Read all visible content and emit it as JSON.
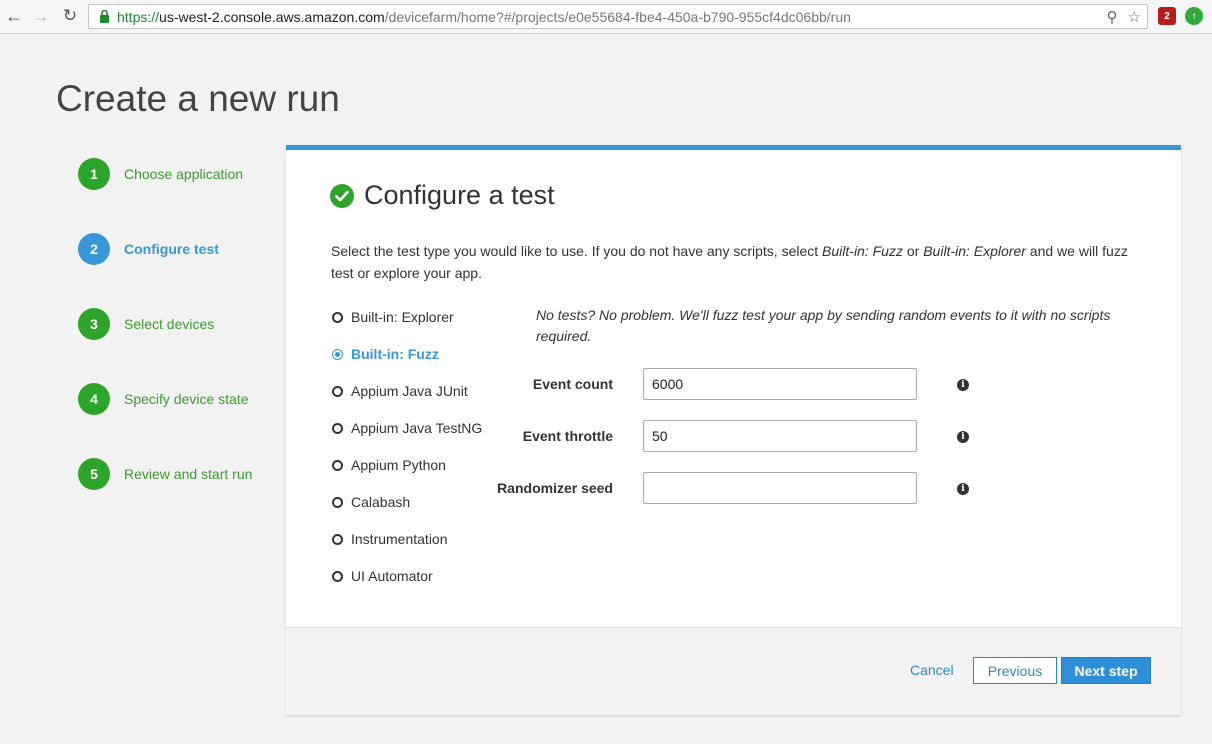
{
  "browser": {
    "url_scheme": "https://",
    "url_host": "us-west-2.console.aws.amazon.com",
    "url_path": "/devicefarm/home?#/projects/e0e55684-fbe4-450a-b790-955cf4dc06bb/run",
    "ext_badge": "2"
  },
  "page": {
    "title": "Create a new run"
  },
  "steps": [
    {
      "num": "1",
      "label": "Choose application"
    },
    {
      "num": "2",
      "label": "Configure test"
    },
    {
      "num": "3",
      "label": "Select devices"
    },
    {
      "num": "4",
      "label": "Specify device state"
    },
    {
      "num": "5",
      "label": "Review and start run"
    }
  ],
  "panel": {
    "title": "Configure a test",
    "intro_part1": "Select the test type you would like to use. If you do not have any scripts, select ",
    "intro_em1": "Built-in: Fuzz",
    "intro_part2": " or ",
    "intro_em2": "Built-in: Explorer",
    "intro_part3": " and we will fuzz test or explore your app.",
    "test_types": [
      "Built-in: Explorer",
      "Built-in: Fuzz",
      "Appium Java JUnit",
      "Appium Java TestNG",
      "Appium Python",
      "Calabash",
      "Instrumentation",
      "UI Automator"
    ],
    "selected_test_type": "Built-in: Fuzz",
    "fuzz_note": "No tests? No problem. We'll fuzz test your app by sending random events to it with no scripts required.",
    "fields": {
      "event_count_label": "Event count",
      "event_count_value": "6000",
      "event_throttle_label": "Event throttle",
      "event_throttle_value": "50",
      "randomizer_seed_label": "Randomizer seed",
      "randomizer_seed_value": ""
    },
    "info_glyph": "i"
  },
  "footer": {
    "cancel_label": "Cancel",
    "previous_label": "Previous",
    "next_label": "Next step"
  },
  "colors": {
    "accent_blue": "#3996d9",
    "step_green": "#2fa42b"
  }
}
